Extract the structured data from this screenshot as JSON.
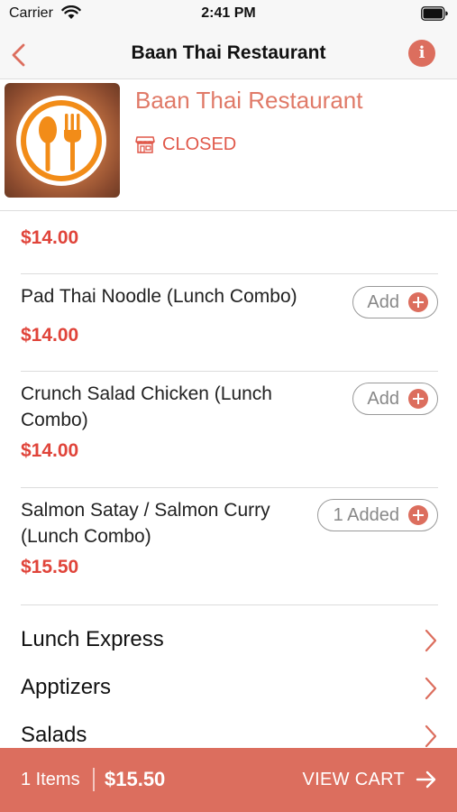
{
  "status_bar": {
    "carrier": "Carrier",
    "time": "2:41 PM"
  },
  "nav": {
    "title": "Baan Thai Restaurant",
    "info_glyph": "i"
  },
  "restaurant": {
    "name": "Baan Thai Restaurant",
    "status": "CLOSED"
  },
  "menu": {
    "partial_item": {
      "price": "$14.00"
    },
    "items": [
      {
        "name": "Pad Thai Noodle (Lunch Combo)",
        "price": "$14.00",
        "action": "Add"
      },
      {
        "name": "Crunch Salad Chicken (Lunch Combo)",
        "price": "$14.00",
        "action": "Add"
      },
      {
        "name": "Salmon Satay / Salmon Curry (Lunch Combo)",
        "price": "$15.50",
        "action": "1 Added"
      }
    ],
    "categories": [
      "Lunch Express",
      "Apptizers",
      "Salads"
    ]
  },
  "cart": {
    "items_count": "1 Items",
    "total": "$15.50",
    "view_cart": "VIEW CART"
  },
  "colors": {
    "accent": "#dc6e5e",
    "price": "#e0443a",
    "restaurant_name": "#e07a68",
    "closed": "#e0584a"
  }
}
